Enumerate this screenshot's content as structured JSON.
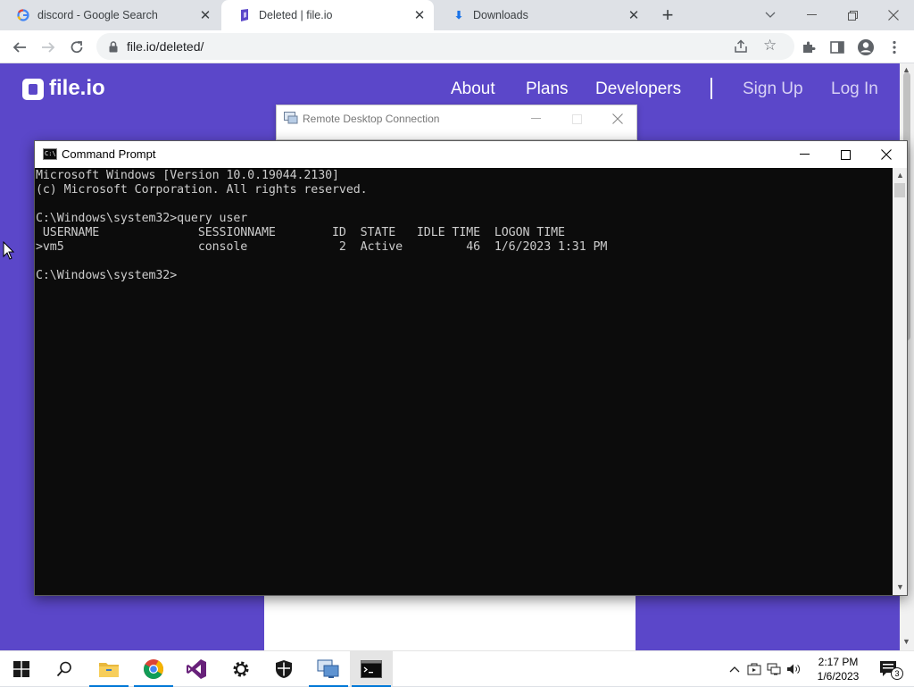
{
  "browser": {
    "tabs": [
      {
        "title": "discord - Google Search",
        "favicon": "google-g-icon",
        "active": false
      },
      {
        "title": "Deleted | file.io",
        "favicon": "fileio-icon",
        "active": true
      },
      {
        "title": "Downloads",
        "favicon": "download-icon",
        "active": false
      }
    ],
    "new_tab_label": "+",
    "url": "file.io/deleted/"
  },
  "site": {
    "logo_text": "file.io",
    "nav": [
      "About",
      "Plans",
      "Developers"
    ],
    "nav_divider": "|",
    "auth": [
      "Sign Up",
      "Log In"
    ],
    "brand_color": "#5b47c9"
  },
  "rdc": {
    "title": "Remote Desktop Connection"
  },
  "cmd": {
    "title": "Command Prompt",
    "lines": [
      "Microsoft Windows [Version 10.0.19044.2130]",
      "(c) Microsoft Corporation. All rights reserved.",
      "",
      "C:\\Windows\\system32>query user",
      " USERNAME              SESSIONNAME        ID  STATE   IDLE TIME  LOGON TIME",
      ">vm5                   console             2  Active         46  1/6/2023 1:31 PM",
      "",
      "C:\\Windows\\system32>"
    ]
  },
  "taskbar": {
    "apps": [
      "start-icon",
      "search-icon",
      "file-explorer-icon",
      "chrome-icon",
      "visual-studio-icon",
      "settings-icon",
      "security-icon",
      "remote-desktop-icon",
      "command-prompt-icon"
    ],
    "time": "2:17 PM",
    "date": "1/6/2023",
    "notification_count": "3"
  }
}
